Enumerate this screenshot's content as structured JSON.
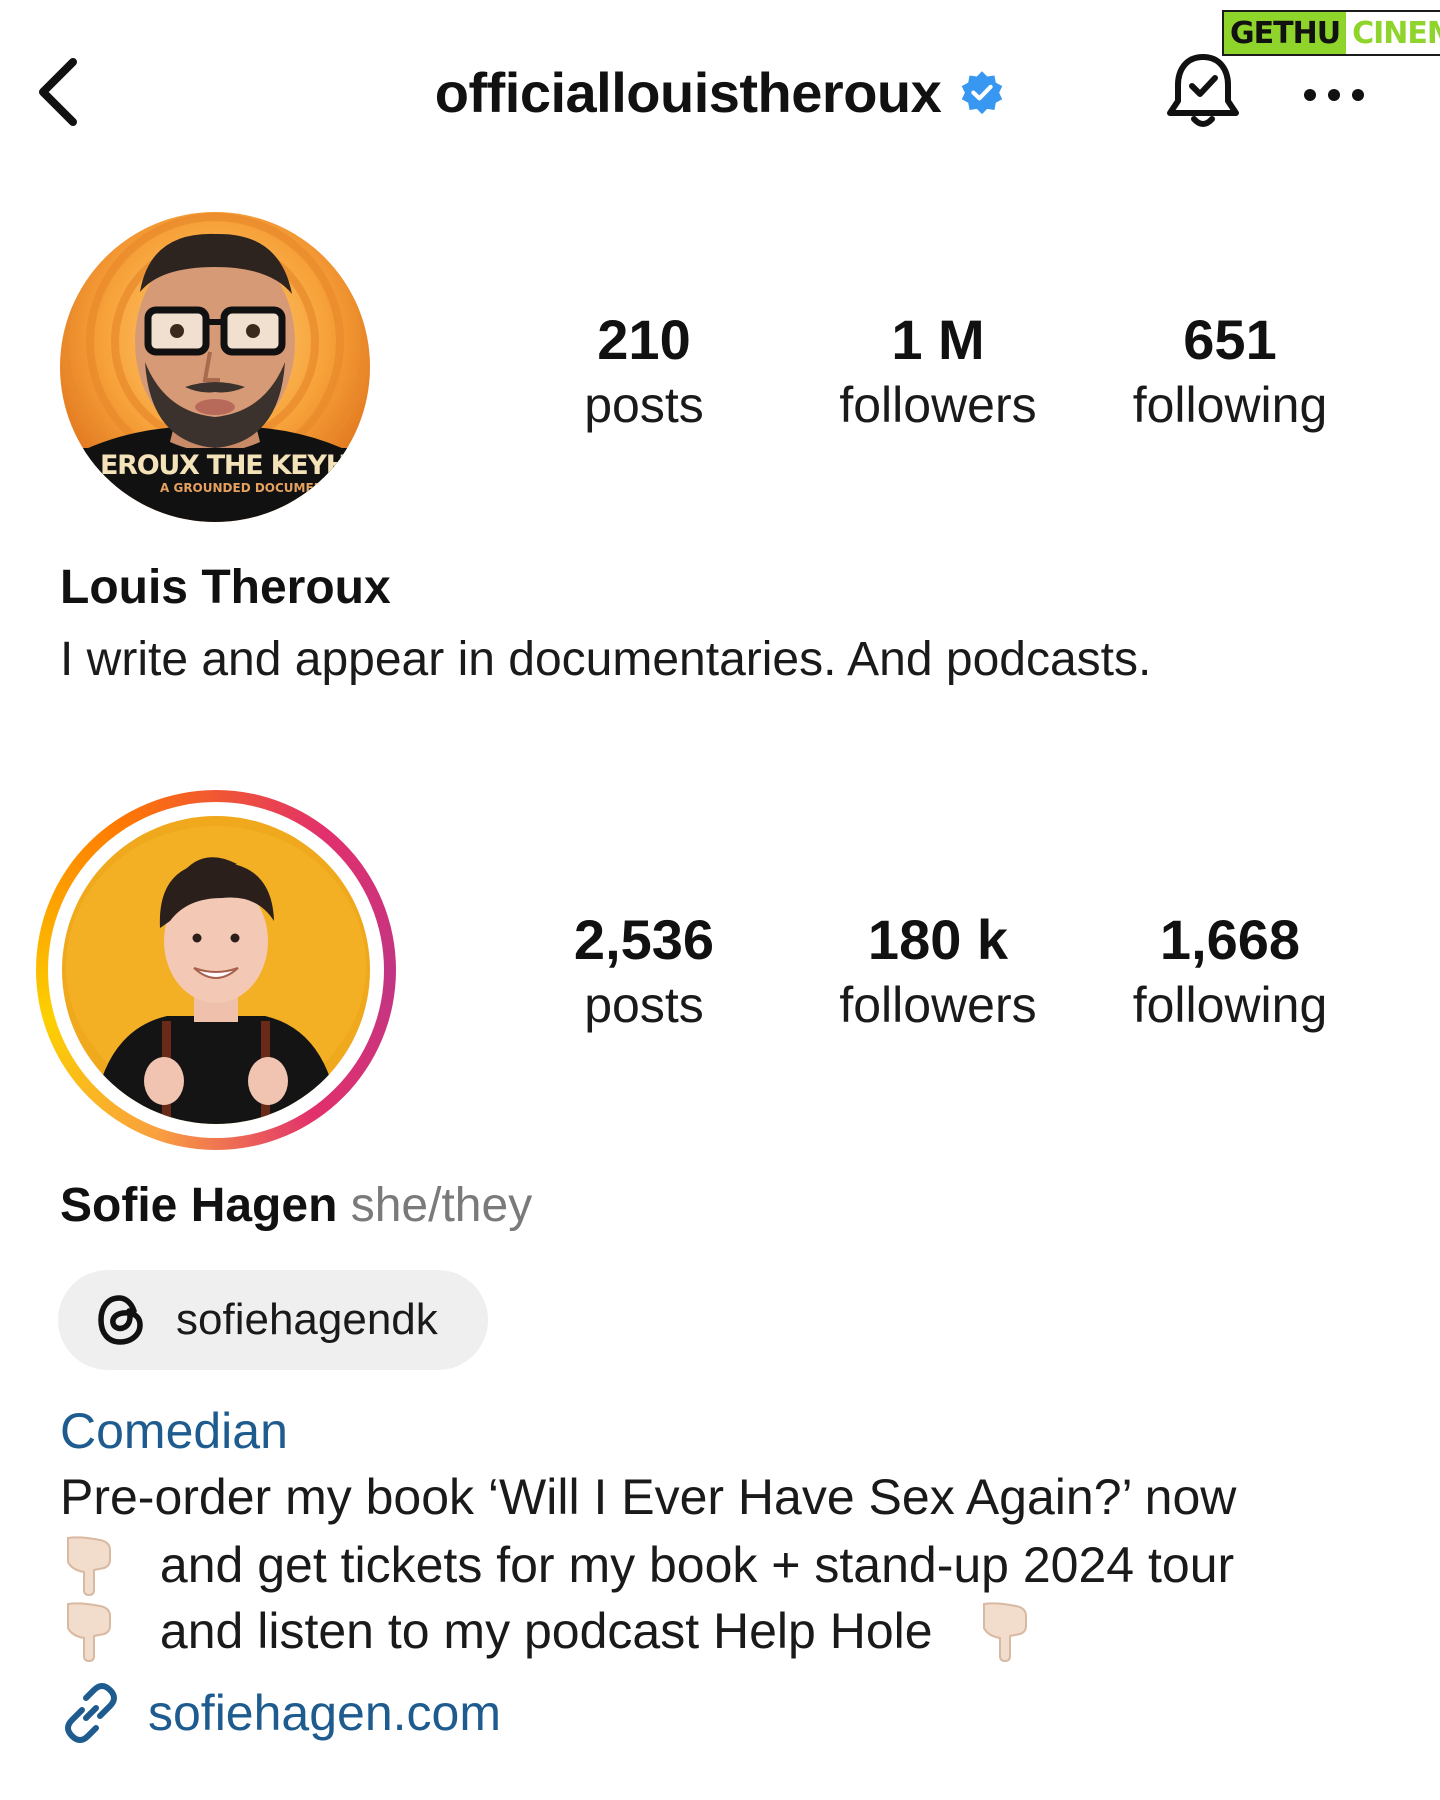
{
  "watermark": {
    "part1": "GETHU",
    "part2": "CINEMA"
  },
  "header": {
    "username": "officiallouistheroux",
    "verified": true,
    "back_icon": "chevron-left-icon",
    "bell_icon": "bell-check-icon",
    "more_icon": "more-horizontal-icon"
  },
  "profile1": {
    "avatar_shirt_text": "EROUX THE KEYHO",
    "avatar_shirt_subtext": "A GROUNDED DOCUMENT",
    "stats": [
      {
        "value": "210",
        "label": "posts"
      },
      {
        "value": "1 M",
        "label": "followers"
      },
      {
        "value": "651",
        "label": "following"
      }
    ],
    "name": "Louis Theroux",
    "bio": "I write and appear in documentaries. And podcasts."
  },
  "profile2": {
    "has_story_ring": true,
    "stats": [
      {
        "value": "2,536",
        "label": "posts"
      },
      {
        "value": "180 k",
        "label": "followers"
      },
      {
        "value": "1,668",
        "label": "following"
      }
    ],
    "name": "Sofie Hagen",
    "pronouns": "she/they",
    "threads_handle": "sofiehagendk",
    "category": "Comedian",
    "bio_lines": [
      "Pre-order my book ‘Will I Ever Have Sex Again?’ now",
      "and get tickets for my book + stand-up 2024 tour",
      "and listen to my podcast Help Hole"
    ],
    "link": "sofiehagen.com"
  },
  "colors": {
    "link_blue": "#1e5b8f",
    "verified_blue": "#3897f0",
    "pill_bg": "#efefef"
  }
}
